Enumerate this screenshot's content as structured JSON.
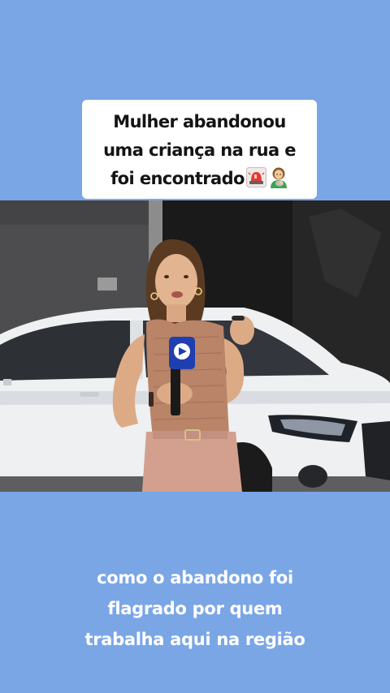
{
  "title": {
    "lines": [
      "Mulher abandonou",
      "uma criança na rua e",
      "foi encontrado"
    ],
    "emojis": [
      "siren-icon",
      "woman-with-baby-icon"
    ]
  },
  "caption": {
    "lines": [
      "como o abandono foi",
      "flagrado por quem",
      "trabalha aqui na região"
    ]
  },
  "video": {
    "scene": "video-frame",
    "colors": {
      "background": "#7aa6e6",
      "car": "#f2f3f5",
      "mic": "#1f3fb0",
      "top": "#b98468"
    }
  }
}
